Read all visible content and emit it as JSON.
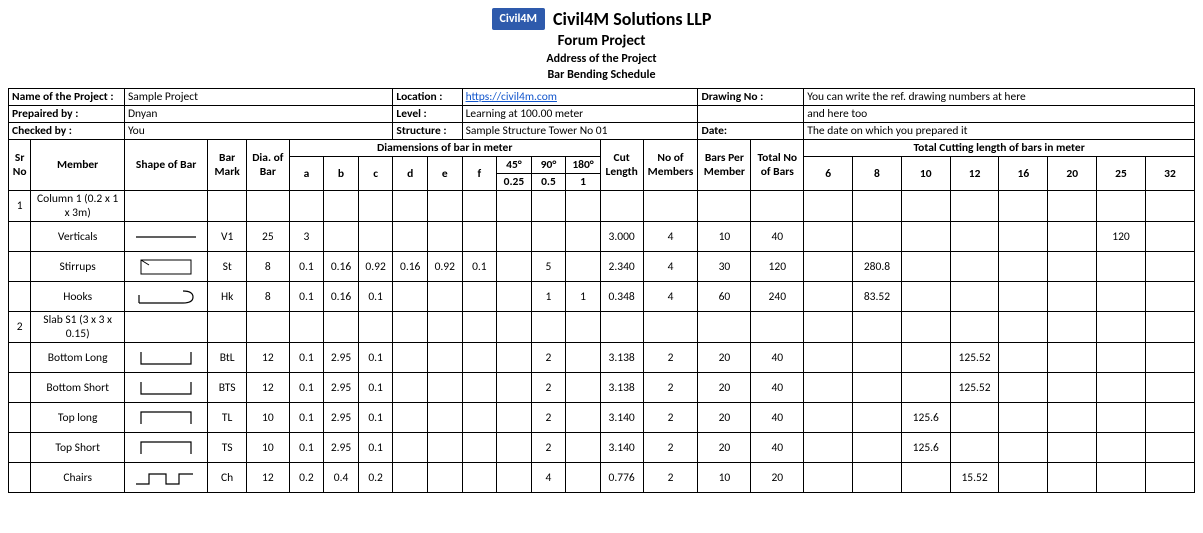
{
  "header": {
    "logo_text": "Civil4M",
    "company": "Civil4M Solutions LLP",
    "project_title": "Forum Project",
    "address": "Address of the Project",
    "doc_title": "Bar Bending Schedule"
  },
  "meta": {
    "row1": {
      "name_lbl": "Name of the Project :",
      "name_val": "Sample Project",
      "location_lbl": "Location :",
      "location_val": "https://civil4m.com",
      "drawing_lbl": "Drawing No :",
      "drawing_val": "You can write the ref. drawing numbers at here"
    },
    "row2": {
      "prepared_lbl": "Prepaired by :",
      "prepared_val": "Dnyan",
      "level_lbl": "Level :",
      "level_val": "Learning at 100.00 meter",
      "drawing_val2": "and here too"
    },
    "row3": {
      "checked_lbl": "Checked by :",
      "checked_val": "You",
      "structure_lbl": "Structure :",
      "structure_val": "Sample Structure Tower No 01",
      "date_lbl": "Date:",
      "date_val": "The date on which you prepared it"
    }
  },
  "headers": {
    "sr": "Sr No",
    "member": "Member",
    "shape": "Shape of Bar",
    "mark": "Bar Mark",
    "dia": "Dia. of Bar",
    "dims_title": "Diamensions of bar in meter",
    "a": "a",
    "b": "b",
    "c": "c",
    "d": "d",
    "e": "e",
    "f": "f",
    "ang45": "45°",
    "ang90": "90°",
    "ang180": "180°",
    "ang45v": "0.25",
    "ang90v": "0.5",
    "ang180v": "1",
    "cut": "Cut Length",
    "nomem": "No of Members",
    "bpm": "Bars Per Member",
    "total": "Total No of Bars",
    "cut_title": "Total Cutting length of bars in meter",
    "d6": "6",
    "d8": "8",
    "d10": "10",
    "d12": "12",
    "d16": "16",
    "d20": "20",
    "d25": "25",
    "d32": "32"
  },
  "rows": [
    {
      "sr": "1",
      "member": "Column 1 (0.2 x 1 x 3m)",
      "shape": "none"
    },
    {
      "member": "Verticals",
      "shape": "straight",
      "mark": "V1",
      "dia": "25",
      "a": "3",
      "cut": "3.000",
      "nomem": "4",
      "bpm": "10",
      "total": "40",
      "l25": "120"
    },
    {
      "member": "Stirrups",
      "shape": "stirrup",
      "mark": "St",
      "dia": "8",
      "a": "0.1",
      "b": "0.16",
      "c": "0.92",
      "d": "0.16",
      "e": "0.92",
      "f": "0.1",
      "ang90": "5",
      "cut": "2.340",
      "nomem": "4",
      "bpm": "30",
      "total": "120",
      "l8": "280.8"
    },
    {
      "member": "Hooks",
      "shape": "hook",
      "mark": "Hk",
      "dia": "8",
      "a": "0.1",
      "b": "0.16",
      "c": "0.1",
      "ang90": "1",
      "ang180": "1",
      "cut": "0.348",
      "nomem": "4",
      "bpm": "60",
      "total": "240",
      "l8": "83.52"
    },
    {
      "sr": "2",
      "member": "Slab S1 (3 x 3 x 0.15)",
      "shape": "none"
    },
    {
      "member": "Bottom Long",
      "shape": "ubar",
      "mark": "BtL",
      "dia": "12",
      "a": "0.1",
      "b": "2.95",
      "c": "0.1",
      "ang90": "2",
      "cut": "3.138",
      "nomem": "2",
      "bpm": "20",
      "total": "40",
      "l12": "125.52"
    },
    {
      "member": "Bottom Short",
      "shape": "ubar",
      "mark": "BTS",
      "dia": "12",
      "a": "0.1",
      "b": "2.95",
      "c": "0.1",
      "ang90": "2",
      "cut": "3.138",
      "nomem": "2",
      "bpm": "20",
      "total": "40",
      "l12": "125.52"
    },
    {
      "member": "Top long",
      "shape": "topbar",
      "mark": "TL",
      "dia": "10",
      "a": "0.1",
      "b": "2.95",
      "c": "0.1",
      "ang90": "2",
      "cut": "3.140",
      "nomem": "2",
      "bpm": "20",
      "total": "40",
      "l10": "125.6"
    },
    {
      "member": "Top Short",
      "shape": "topbar",
      "mark": "TS",
      "dia": "10",
      "a": "0.1",
      "b": "2.95",
      "c": "0.1",
      "ang90": "2",
      "cut": "3.140",
      "nomem": "2",
      "bpm": "20",
      "total": "40",
      "l10": "125.6"
    },
    {
      "member": "Chairs",
      "shape": "chair",
      "mark": "Ch",
      "dia": "12",
      "a": "0.2",
      "b": "0.4",
      "c": "0.2",
      "ang90": "4",
      "cut": "0.776",
      "nomem": "2",
      "bpm": "10",
      "total": "20",
      "l12": "15.52"
    }
  ]
}
